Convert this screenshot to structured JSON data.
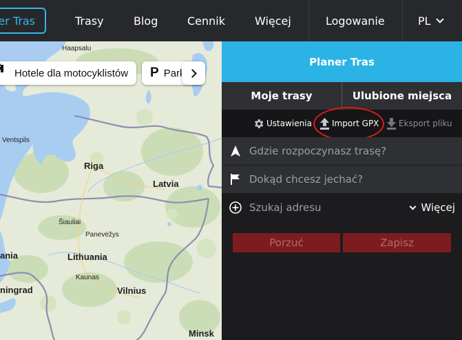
{
  "nav": {
    "active_label": "Planer Tras",
    "items": [
      "Trasy",
      "Blog",
      "Cennik",
      "Więcej",
      "Logowanie"
    ],
    "language": "PL"
  },
  "map": {
    "chips": [
      {
        "icon": "bed-icon",
        "label": "Hotele dla motocyklistów"
      },
      {
        "icon": "parking-icon",
        "label": "Parkingi"
      }
    ],
    "places": [
      "Haapsalu",
      "Ventspils",
      "Riga",
      "Latvia",
      "Šiauliai",
      "Panevėžys",
      "Lithuania",
      "Kaunas",
      "Vilnius",
      "Minsk",
      "ania",
      "ningrad"
    ]
  },
  "panel": {
    "header_title": "Planer Tras",
    "tabs": [
      "Moje trasy",
      "Ulubione miejsca"
    ],
    "toolbar": [
      {
        "icon": "gear-icon",
        "label": "Ustawienia",
        "enabled": true
      },
      {
        "icon": "upload-icon",
        "label": "Import GPX",
        "enabled": true
      },
      {
        "icon": "download-icon",
        "label": "Eksport pliku",
        "enabled": false
      }
    ],
    "start_placeholder": "Gdzie rozpoczynasz trasę?",
    "destination_placeholder": "Dokąd chcesz jechać?",
    "search_placeholder": "Szukaj adresu",
    "more_label": "Więcej",
    "discard_label": "Porzuć",
    "save_label": "Zapisz"
  },
  "colors": {
    "accent": "#2bb3e6",
    "nav_bg": "#26282c",
    "panel_bg": "#1c1c1e",
    "button_bg": "#7d1c1f",
    "highlight": "#e0191b"
  }
}
